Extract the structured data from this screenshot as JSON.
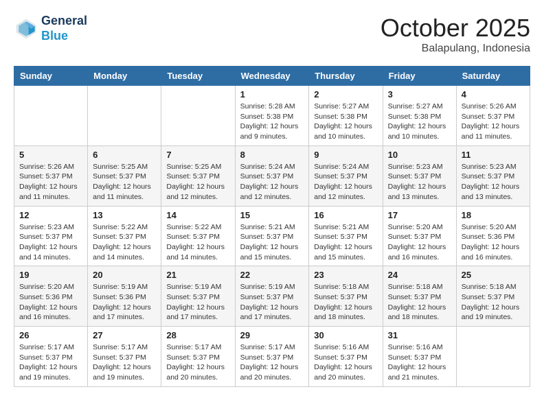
{
  "header": {
    "logo_line1": "General",
    "logo_line2": "Blue",
    "month": "October 2025",
    "location": "Balapulang, Indonesia"
  },
  "days_of_week": [
    "Sunday",
    "Monday",
    "Tuesday",
    "Wednesday",
    "Thursday",
    "Friday",
    "Saturday"
  ],
  "weeks": [
    [
      {
        "day": "",
        "info": ""
      },
      {
        "day": "",
        "info": ""
      },
      {
        "day": "",
        "info": ""
      },
      {
        "day": "1",
        "info": "Sunrise: 5:28 AM\nSunset: 5:38 PM\nDaylight: 12 hours and 9 minutes."
      },
      {
        "day": "2",
        "info": "Sunrise: 5:27 AM\nSunset: 5:38 PM\nDaylight: 12 hours and 10 minutes."
      },
      {
        "day": "3",
        "info": "Sunrise: 5:27 AM\nSunset: 5:38 PM\nDaylight: 12 hours and 10 minutes."
      },
      {
        "day": "4",
        "info": "Sunrise: 5:26 AM\nSunset: 5:37 PM\nDaylight: 12 hours and 11 minutes."
      }
    ],
    [
      {
        "day": "5",
        "info": "Sunrise: 5:26 AM\nSunset: 5:37 PM\nDaylight: 12 hours and 11 minutes."
      },
      {
        "day": "6",
        "info": "Sunrise: 5:25 AM\nSunset: 5:37 PM\nDaylight: 12 hours and 11 minutes."
      },
      {
        "day": "7",
        "info": "Sunrise: 5:25 AM\nSunset: 5:37 PM\nDaylight: 12 hours and 12 minutes."
      },
      {
        "day": "8",
        "info": "Sunrise: 5:24 AM\nSunset: 5:37 PM\nDaylight: 12 hours and 12 minutes."
      },
      {
        "day": "9",
        "info": "Sunrise: 5:24 AM\nSunset: 5:37 PM\nDaylight: 12 hours and 12 minutes."
      },
      {
        "day": "10",
        "info": "Sunrise: 5:23 AM\nSunset: 5:37 PM\nDaylight: 12 hours and 13 minutes."
      },
      {
        "day": "11",
        "info": "Sunrise: 5:23 AM\nSunset: 5:37 PM\nDaylight: 12 hours and 13 minutes."
      }
    ],
    [
      {
        "day": "12",
        "info": "Sunrise: 5:23 AM\nSunset: 5:37 PM\nDaylight: 12 hours and 14 minutes."
      },
      {
        "day": "13",
        "info": "Sunrise: 5:22 AM\nSunset: 5:37 PM\nDaylight: 12 hours and 14 minutes."
      },
      {
        "day": "14",
        "info": "Sunrise: 5:22 AM\nSunset: 5:37 PM\nDaylight: 12 hours and 14 minutes."
      },
      {
        "day": "15",
        "info": "Sunrise: 5:21 AM\nSunset: 5:37 PM\nDaylight: 12 hours and 15 minutes."
      },
      {
        "day": "16",
        "info": "Sunrise: 5:21 AM\nSunset: 5:37 PM\nDaylight: 12 hours and 15 minutes."
      },
      {
        "day": "17",
        "info": "Sunrise: 5:20 AM\nSunset: 5:37 PM\nDaylight: 12 hours and 16 minutes."
      },
      {
        "day": "18",
        "info": "Sunrise: 5:20 AM\nSunset: 5:36 PM\nDaylight: 12 hours and 16 minutes."
      }
    ],
    [
      {
        "day": "19",
        "info": "Sunrise: 5:20 AM\nSunset: 5:36 PM\nDaylight: 12 hours and 16 minutes."
      },
      {
        "day": "20",
        "info": "Sunrise: 5:19 AM\nSunset: 5:36 PM\nDaylight: 12 hours and 17 minutes."
      },
      {
        "day": "21",
        "info": "Sunrise: 5:19 AM\nSunset: 5:37 PM\nDaylight: 12 hours and 17 minutes."
      },
      {
        "day": "22",
        "info": "Sunrise: 5:19 AM\nSunset: 5:37 PM\nDaylight: 12 hours and 17 minutes."
      },
      {
        "day": "23",
        "info": "Sunrise: 5:18 AM\nSunset: 5:37 PM\nDaylight: 12 hours and 18 minutes."
      },
      {
        "day": "24",
        "info": "Sunrise: 5:18 AM\nSunset: 5:37 PM\nDaylight: 12 hours and 18 minutes."
      },
      {
        "day": "25",
        "info": "Sunrise: 5:18 AM\nSunset: 5:37 PM\nDaylight: 12 hours and 19 minutes."
      }
    ],
    [
      {
        "day": "26",
        "info": "Sunrise: 5:17 AM\nSunset: 5:37 PM\nDaylight: 12 hours and 19 minutes."
      },
      {
        "day": "27",
        "info": "Sunrise: 5:17 AM\nSunset: 5:37 PM\nDaylight: 12 hours and 19 minutes."
      },
      {
        "day": "28",
        "info": "Sunrise: 5:17 AM\nSunset: 5:37 PM\nDaylight: 12 hours and 20 minutes."
      },
      {
        "day": "29",
        "info": "Sunrise: 5:17 AM\nSunset: 5:37 PM\nDaylight: 12 hours and 20 minutes."
      },
      {
        "day": "30",
        "info": "Sunrise: 5:16 AM\nSunset: 5:37 PM\nDaylight: 12 hours and 20 minutes."
      },
      {
        "day": "31",
        "info": "Sunrise: 5:16 AM\nSunset: 5:37 PM\nDaylight: 12 hours and 21 minutes."
      },
      {
        "day": "",
        "info": ""
      }
    ]
  ]
}
